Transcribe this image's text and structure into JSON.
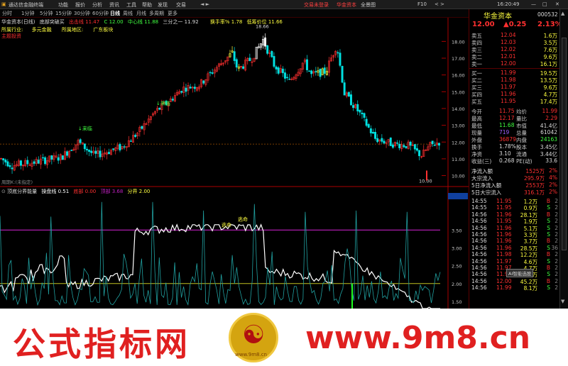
{
  "titlebar": {
    "app_name": "通达信金融终端",
    "menu": [
      "功能",
      "报价",
      "分析",
      "资讯",
      "工具",
      "帮助",
      "发现",
      "交易"
    ],
    "center_text": "交易未登录",
    "center_sub": "华金资本",
    "nav": [
      "全景图",
      "F10",
      "<",
      ">"
    ],
    "time": "16:20:49"
  },
  "periodbar": {
    "items": [
      "分时",
      "1分钟",
      "5分钟",
      "15分钟",
      "30分钟",
      "60分钟",
      "日线",
      "周线",
      "月线",
      "多周期",
      "更多"
    ]
  },
  "chart": {
    "header": {
      "stock": "华金资本(日线)",
      "formula": "底部突破买",
      "buy_label": "出击线",
      "buy_value": "11.47",
      "c_label": "C",
      "c_value": "12.00",
      "mid_label": "中心线",
      "mid_value": "11.88",
      "third_label": "三分之一",
      "third_value": "11.92",
      "turn_label": "换手率%",
      "turn_value": "1.78",
      "low_label": "低筹价位",
      "low_value": "11.66"
    },
    "tags": {
      "industry_label": "所属行业:",
      "industry": "多元金融",
      "region_label": "所属地区:",
      "region": "广东板块",
      "flag": "主题投资"
    },
    "peak_label": "18.66",
    "low_label": "10.00",
    "marker_top": "来临",
    "marker_left": "来临",
    "bottom_note": "周期K:(未指定)",
    "y_ticks": [
      "18.00",
      "17.00",
      "16.00",
      "15.00",
      "14.00",
      "13.00",
      "12.00",
      "11.00",
      "10.00"
    ],
    "indicator": {
      "name": "顶底分界能量",
      "line_label": "操盘线",
      "line_value": "0.51",
      "bottom_label": "底部",
      "bottom_value": "0.00",
      "top_label": "顶部",
      "top_value": "3.68",
      "split_label": "分界",
      "split_value": "2.00",
      "peak_words": [
        "逃命",
        "逃命"
      ],
      "y_ticks": [
        "4.44",
        "3.50",
        "3.00",
        "2.50",
        "2.00",
        "1.50"
      ]
    }
  },
  "quote": {
    "name": "华金资本",
    "code": "000532",
    "price": "12.00",
    "change": "▲0.25",
    "pct": "2.13%",
    "asks": [
      {
        "label": "卖五",
        "price": "12.04",
        "vol": "1.6万"
      },
      {
        "label": "卖四",
        "price": "12.03",
        "vol": "3.5万"
      },
      {
        "label": "卖三",
        "price": "12.02",
        "vol": "7.6万"
      },
      {
        "label": "卖二",
        "price": "12.01",
        "vol": "9.6万"
      },
      {
        "label": "卖一",
        "price": "12.00",
        "vol": "16.1万"
      }
    ],
    "bids": [
      {
        "label": "买一",
        "price": "11.99",
        "vol": "19.5万"
      },
      {
        "label": "买二",
        "price": "11.98",
        "vol": "13.5万"
      },
      {
        "label": "买三",
        "price": "11.97",
        "vol": "9.6万"
      },
      {
        "label": "买四",
        "price": "11.96",
        "vol": "4.7万"
      },
      {
        "label": "买五",
        "price": "11.95",
        "vol": "17.4万"
      }
    ],
    "stats": [
      {
        "l1": "今开",
        "v1": "11.75",
        "l2": "均价",
        "v2": "11.99"
      },
      {
        "l1": "最高",
        "v1": "12.17",
        "l2": "量比",
        "v2": "2.29"
      },
      {
        "l1": "最低",
        "v1": "11.68",
        "l2": "市值",
        "v2": "41.4亿"
      },
      {
        "l1": "现量",
        "v1": "719",
        "l2": "总量",
        "v2": "61042"
      },
      {
        "l1": "外盘",
        "v1": "36879",
        "l2": "内盘",
        "v2": "24163"
      },
      {
        "l1": "换手",
        "v1": "1.78%",
        "l2": "股本",
        "v2": "3.45亿"
      },
      {
        "l1": "净资",
        "v1": "3.10",
        "l2": "流通",
        "v2": "3.44亿"
      },
      {
        "l1": "收益(三)",
        "v1": "0.268",
        "l2": "PE(动)",
        "v2": "33.6"
      }
    ],
    "flows": [
      {
        "label": "净流入额",
        "val": "1525万",
        "pct": "2%"
      },
      {
        "label": "大宗流入",
        "val": "295.9万",
        "pct": "4%"
      },
      {
        "label": "5日净流入额",
        "val": "2553万",
        "pct": "2%"
      },
      {
        "label": "5日大宗流入",
        "val": "316.1万",
        "pct": "2%"
      }
    ],
    "ticks": [
      {
        "t": "14:55",
        "p": "11.95",
        "v": "1.2万",
        "s": "B",
        "n": "2"
      },
      {
        "t": "14:55",
        "p": "11.95",
        "v": "0.9万",
        "s": "S",
        "n": "2"
      },
      {
        "t": "14:56",
        "p": "11.96",
        "v": "28.1万",
        "s": "B",
        "n": "2"
      },
      {
        "t": "14:56",
        "p": "11.95",
        "v": "1.9万",
        "s": "S",
        "n": "2"
      },
      {
        "t": "14:56",
        "p": "11.96",
        "v": "5.1万",
        "s": "S",
        "n": "2"
      },
      {
        "t": "14:56",
        "p": "11.96",
        "v": "3.3万",
        "s": "S",
        "n": "2"
      },
      {
        "t": "14:56",
        "p": "11.96",
        "v": "3.7万",
        "s": "B",
        "n": "2"
      },
      {
        "t": "14:56",
        "p": "11.96",
        "v": "28.5万",
        "s": "S",
        "n": "36"
      },
      {
        "t": "14:56",
        "p": "11.98",
        "v": "12.2万",
        "s": "B",
        "n": "2"
      },
      {
        "t": "14:56",
        "p": "11.97",
        "v": "4.6万",
        "s": "S",
        "n": "2"
      },
      {
        "t": "14:56",
        "p": "11.97",
        "v": "4.7万",
        "s": "B",
        "n": "2"
      },
      {
        "t": "14:56",
        "p": "11.97",
        "v": "0.9万",
        "s": "S",
        "n": "2"
      },
      {
        "t": "14:56",
        "p": "12.00",
        "v": "45.2万",
        "s": "B",
        "n": "2"
      },
      {
        "t": "14:56",
        "p": "11.99",
        "v": "8.1万",
        "s": "S",
        "n": "2"
      }
    ],
    "popup": "AI智能选股"
  },
  "footer": {
    "left_text": "公式指标网",
    "right_text": "www.9m8.cn",
    "logo_sub": "www.9m8.cn"
  },
  "colors": {
    "up": "#ff3030",
    "down": "#00e0e0",
    "yellow": "#ffff40",
    "magenta": "#c020c0",
    "white": "#ffffff"
  }
}
